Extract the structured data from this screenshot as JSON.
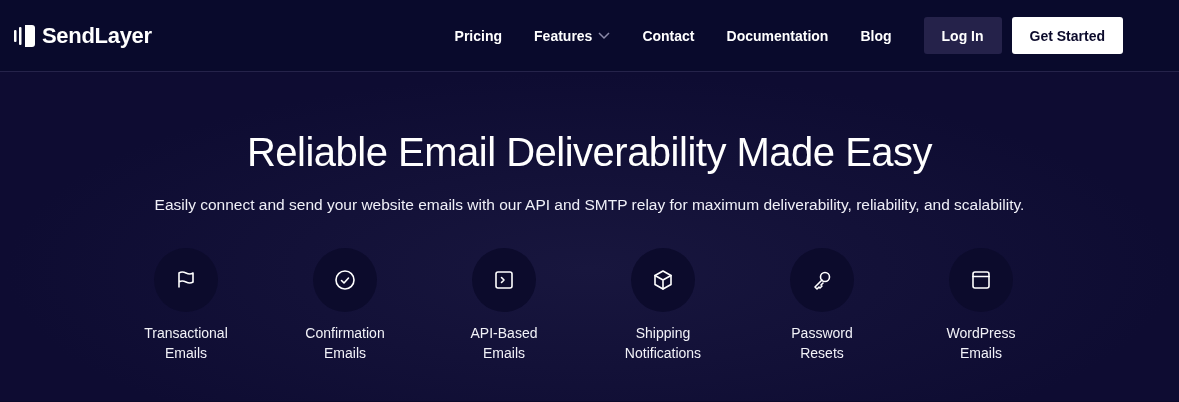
{
  "header": {
    "logo": "SendLayer",
    "nav": [
      {
        "label": "Pricing",
        "dropdown": false
      },
      {
        "label": "Features",
        "dropdown": true
      },
      {
        "label": "Contact",
        "dropdown": false
      },
      {
        "label": "Documentation",
        "dropdown": false
      },
      {
        "label": "Blog",
        "dropdown": false
      }
    ],
    "buttons": [
      {
        "label": "Log In",
        "kind": "secondary"
      },
      {
        "label": "Get Started",
        "kind": "primary"
      }
    ]
  },
  "hero": {
    "title": "Reliable Email Deliverability Made Easy",
    "subtitle": "Easily connect and send your website emails with our API and SMTP relay for maximum deliverability, reliability, and scalability."
  },
  "features": [
    {
      "kind": "flag",
      "lines": [
        "Transactional",
        "Emails"
      ]
    },
    {
      "kind": "check",
      "lines": [
        "Confirmation",
        "Emails"
      ]
    },
    {
      "kind": "terminal",
      "lines": [
        "API-Based",
        "Emails"
      ]
    },
    {
      "kind": "box",
      "lines": [
        "Shipping",
        "Notifications"
      ]
    },
    {
      "kind": "key",
      "lines": [
        "Password",
        "Resets"
      ]
    },
    {
      "kind": "window",
      "lines": [
        "WordPress",
        "Emails"
      ]
    }
  ]
}
